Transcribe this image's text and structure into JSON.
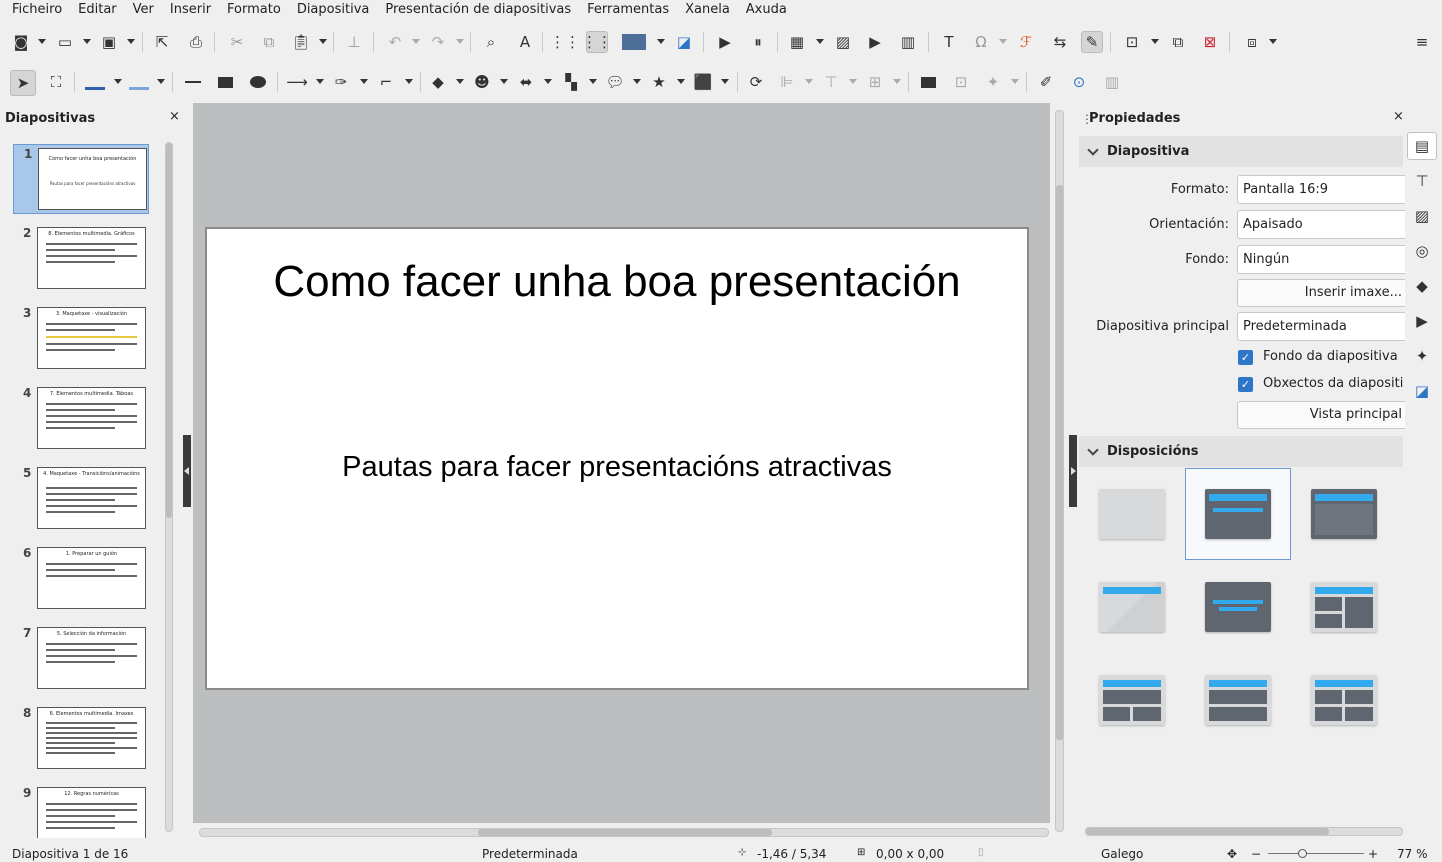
{
  "menu": [
    "Ficheiro",
    "Editar",
    "Ver",
    "Inserir",
    "Formato",
    "Diapositiva",
    "Presentación de diapositivas",
    "Ferramentas",
    "Xanela",
    "Axuda"
  ],
  "slide_pane": {
    "title": "Diapositivas",
    "close": "×",
    "slides": [
      {
        "num": "1",
        "title": "Como facer unha boa presentación",
        "sub": "Pautas para facer presentacións atractivas"
      },
      {
        "num": "2",
        "title": "8. Elementos multimedia. Gráficos"
      },
      {
        "num": "3",
        "title": "3. Maquetaxe - visualización"
      },
      {
        "num": "4",
        "title": "7. Elementos multimedia. Táboas"
      },
      {
        "num": "5",
        "title": "4. Maquetaxe - Transicións/animacións"
      },
      {
        "num": "6",
        "title": "1. Preparar un guión"
      },
      {
        "num": "7",
        "title": "5. Selección da información"
      },
      {
        "num": "8",
        "title": "6. Elementos multimedia. Imaxes"
      },
      {
        "num": "9",
        "title": "12. Regras numéricas"
      }
    ]
  },
  "slide": {
    "title": "Como facer unha boa presentación",
    "subtitle": "Pautas para facer presentacións atractivas"
  },
  "properties": {
    "title": "Propiedades",
    "close": "×",
    "section_slide": "Diapositiva",
    "format_label": "Formato:",
    "format_value": "Pantalla 16:9",
    "orientation_label": "Orientación:",
    "orientation_value": "Apaisado",
    "background_label": "Fondo:",
    "background_value": "Ningún",
    "insert_image_button": "Inserir imaxe...",
    "master_slide_label": "Diapositiva principal",
    "master_slide_value": "Predeterminada",
    "master_background_checkbox": "Fondo da diapositiva",
    "master_objects_checkbox": "Obxectos da diapositi",
    "master_view_button": "Vista principal",
    "section_layouts": "Disposicións"
  },
  "statusbar": {
    "slide_count": "Diapositiva 1 de 16",
    "master": "Predeterminada",
    "position": "-1,46 / 5,34",
    "size": "0,00 x 0,00",
    "language": "Galego",
    "zoom": "77 %"
  },
  "colors": {
    "accent": "#2f76c8",
    "layout_bar": "#33aaee",
    "layout_block": "#5f6670",
    "selection": "#a9c7e9"
  }
}
